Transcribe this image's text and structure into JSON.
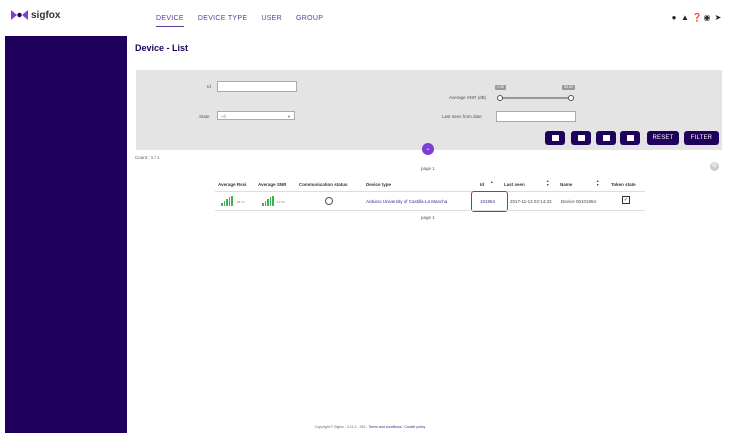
{
  "header": {
    "brand": "sigfox",
    "nav": [
      "DEVICE",
      "DEVICE TYPE",
      "USER",
      "GROUP"
    ],
    "active_nav": "DEVICE",
    "icons": [
      "user-icon",
      "alert-icon",
      "help-icon",
      "eye-icon",
      "logout-icon"
    ]
  },
  "page": {
    "title": "Device - List"
  },
  "filters": {
    "id_label": "Id",
    "id_value": "",
    "state_label": "State",
    "state_value": "All",
    "snr_label": "Average SNR (dB)",
    "snr_min": "1.00",
    "snr_max": "30.00",
    "last_seen_label": "Last seen from date",
    "last_seen_value": ""
  },
  "buttons": {
    "reset": "RESET",
    "filter": "FILTER",
    "icon_buttons": [
      "folder-icon",
      "save-icon",
      "delete-icon",
      "export-icon"
    ]
  },
  "list": {
    "count": "Count : 1 / 1",
    "page_top": "page 1",
    "page_bottom": "page 1",
    "columns": [
      "Average Rssi",
      "Average SNR",
      "Communication status",
      "Device type",
      "Id",
      "Last seen",
      "Name",
      "Token state"
    ],
    "rows": [
      {
        "rssi": "-98.74",
        "snr": "10.59",
        "device_type": "Arduino University of Castilla-La Mancha",
        "id": "101954",
        "last_seen": "2017-11-13 02:14:33",
        "name": "Device 00101954",
        "token_checked": true
      }
    ]
  },
  "footer": {
    "prefix": "Copyright © Sigfox - 0.11.2 - 249 - ",
    "terms": "Terms and conditions",
    "sep": " / ",
    "cookie": "Cookie policy"
  },
  "colors": {
    "primary": "#1f005c",
    "accent": "#7b3fd6",
    "signal": "#3cb44b",
    "highlight": "#e02020"
  }
}
